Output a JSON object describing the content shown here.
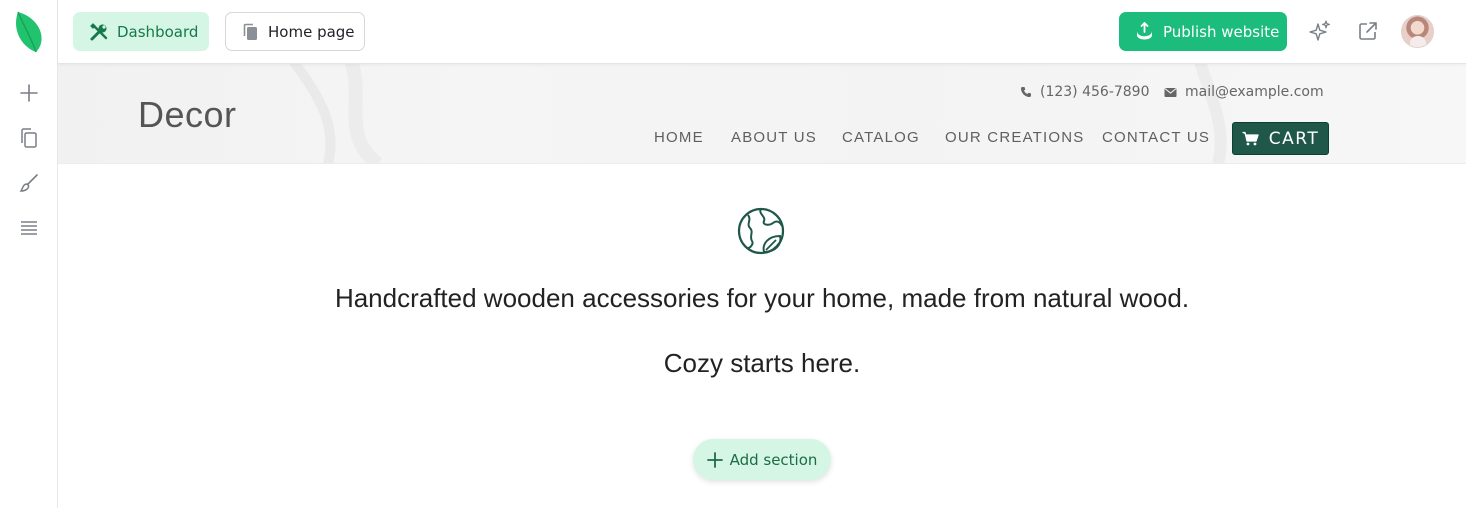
{
  "topbar": {
    "dashboard_label": "Dashboard",
    "home_label": "Home page",
    "publish_label": "Publish website"
  },
  "sidebar": {
    "items": [
      {
        "icon": "plus-icon"
      },
      {
        "icon": "pages-icon"
      },
      {
        "icon": "brush-icon"
      },
      {
        "icon": "layers-icon"
      }
    ]
  },
  "site": {
    "brand": "Decor",
    "phone": "(123) 456-7890",
    "email": "mail@example.com",
    "nav": [
      "HOME",
      "ABOUT US",
      "CATALOG",
      "OUR CREATIONS",
      "CONTACT US"
    ],
    "cart_label": "CART"
  },
  "hero": {
    "line1": "Handcrafted wooden accessories for your home, made from natural wood.",
    "line2": "Cozy starts here."
  },
  "add_section_label": "Add section",
  "colors": {
    "accent_green": "#1cbc7c",
    "light_green": "#d5f6e4",
    "dark_green": "#1f5849"
  }
}
